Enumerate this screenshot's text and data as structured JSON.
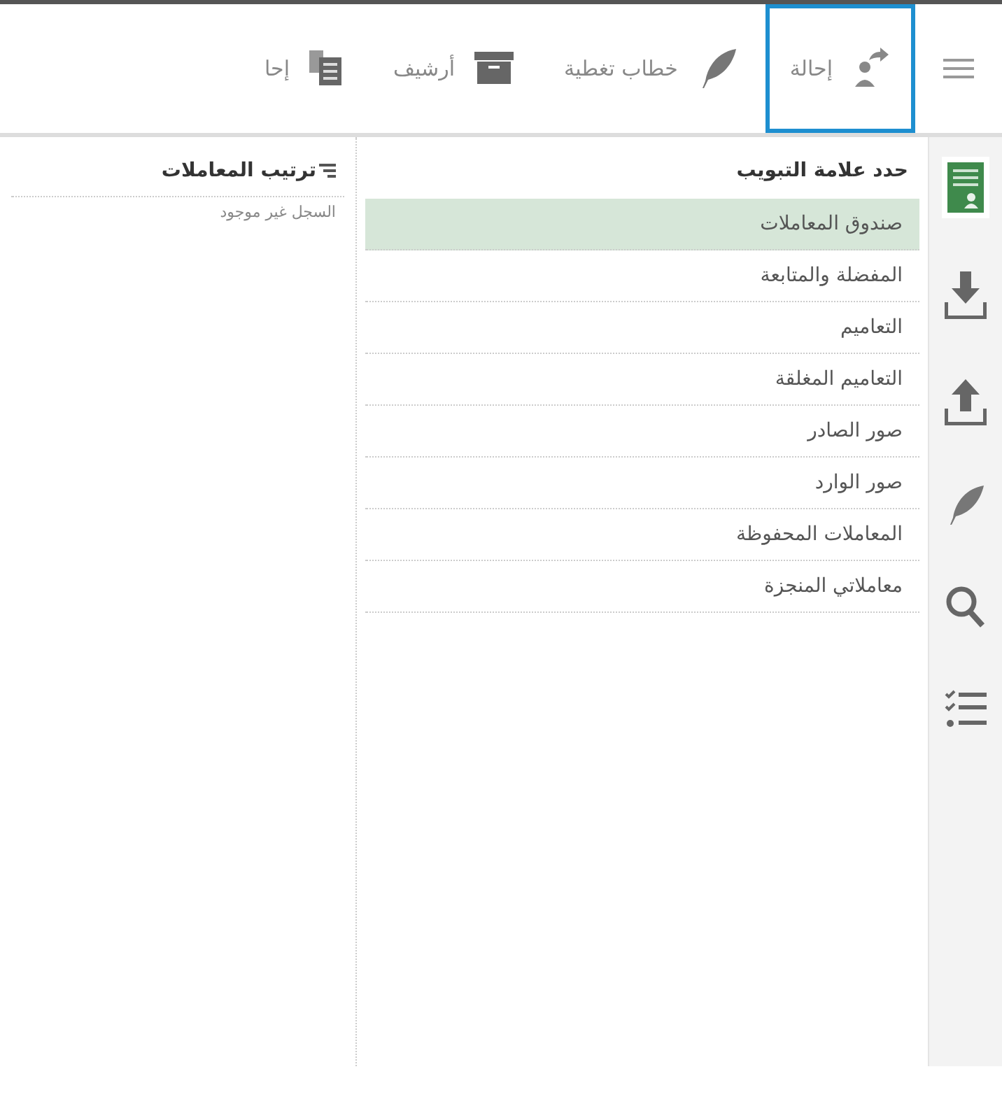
{
  "toolbar": {
    "items": [
      {
        "label": "إحالة",
        "kind": "forward",
        "selected": true
      },
      {
        "label": "خطاب تغطية",
        "kind": "feather",
        "selected": false
      },
      {
        "label": "أرشيف",
        "kind": "archive",
        "selected": false
      },
      {
        "label": "إحا",
        "kind": "copy",
        "selected": false
      }
    ]
  },
  "sidebar": {
    "items": [
      {
        "kind": "document",
        "selected": true
      },
      {
        "kind": "inbox",
        "selected": false
      },
      {
        "kind": "outbox",
        "selected": false
      },
      {
        "kind": "feather",
        "selected": false
      },
      {
        "kind": "search",
        "selected": false
      },
      {
        "kind": "checklist",
        "selected": false
      }
    ]
  },
  "tabs_panel": {
    "title": "حدد علامة التبويب",
    "items": [
      {
        "label": "صندوق المعاملات",
        "selected": true
      },
      {
        "label": "المفضلة والمتابعة",
        "selected": false
      },
      {
        "label": "التعاميم",
        "selected": false
      },
      {
        "label": "التعاميم المغلقة",
        "selected": false
      },
      {
        "label": "صور الصادر",
        "selected": false
      },
      {
        "label": "صور الوارد",
        "selected": false
      },
      {
        "label": "المعاملات المحفوظة",
        "selected": false
      },
      {
        "label": "معاملاتي المنجزة",
        "selected": false
      }
    ]
  },
  "sort_panel": {
    "title": "ترتيب المعاملات",
    "message": "السجل غير موجود"
  }
}
